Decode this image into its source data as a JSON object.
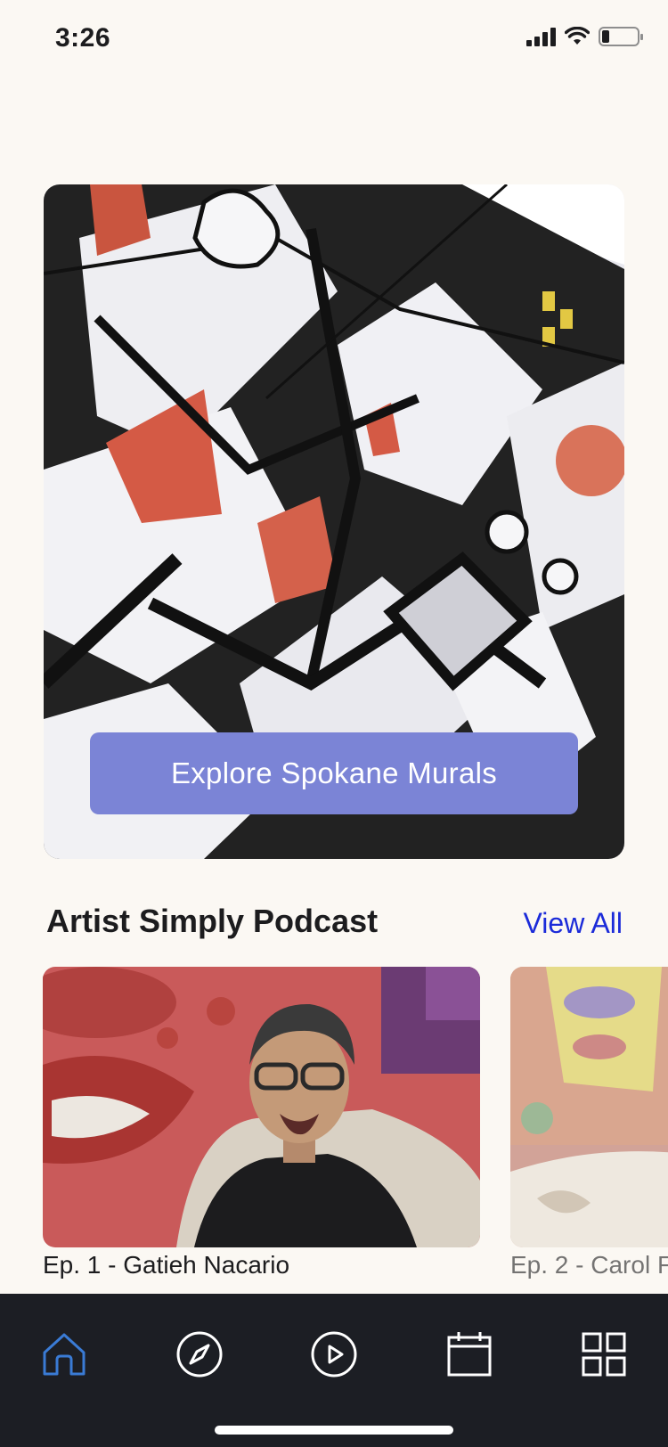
{
  "status_bar": {
    "time": "3:26"
  },
  "hero": {
    "button_label": "Explore Spokane Murals"
  },
  "podcast_section": {
    "title": "Artist Simply Podcast",
    "view_all_label": "View All",
    "episodes": [
      {
        "title": "Ep. 1 - Gatieh Nacario"
      },
      {
        "title": "Ep. 2 - Carol F"
      }
    ]
  },
  "tab_bar": {
    "items": [
      {
        "icon": "home-icon",
        "active": true
      },
      {
        "icon": "compass-icon",
        "active": false
      },
      {
        "icon": "play-icon",
        "active": false
      },
      {
        "icon": "calendar-icon",
        "active": false
      },
      {
        "icon": "grid-icon",
        "active": false
      }
    ],
    "colors": {
      "active": "#3a7bd5",
      "inactive": "#ffffff",
      "background": "#1c1e24"
    }
  },
  "colors": {
    "accent_button": "#7b84d6",
    "link": "#1b2bd9",
    "page_background": "#fbf8f3"
  }
}
